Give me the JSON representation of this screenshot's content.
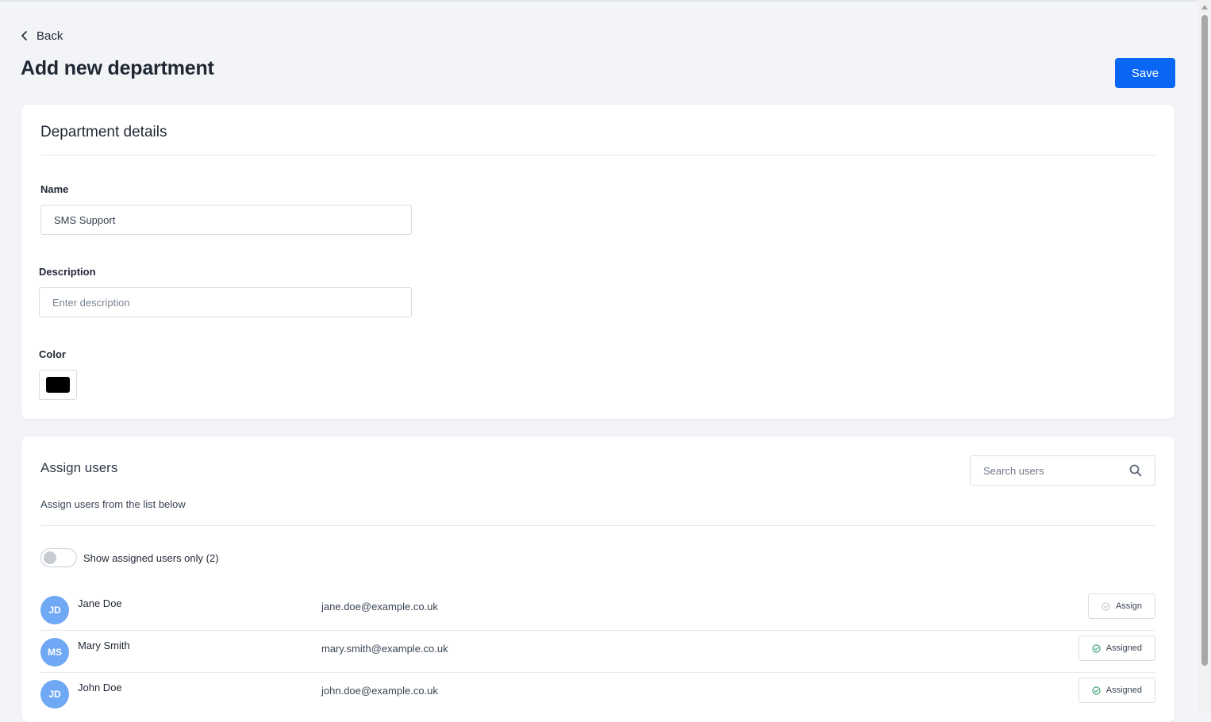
{
  "header": {
    "back_label": "Back",
    "page_title": "Add new department",
    "save_label": "Save"
  },
  "details": {
    "title": "Department details",
    "name_label": "Name",
    "name_value": "SMS Support",
    "description_label": "Description",
    "description_placeholder": "Enter description",
    "color_label": "Color",
    "color_value": "#000000"
  },
  "assign": {
    "title": "Assign users",
    "subtitle": "Assign users from the list below",
    "search_placeholder": "Search users",
    "toggle_label": "Show assigned users only (2)",
    "users": [
      {
        "initials": "JD",
        "name": "Jane Doe",
        "email": "jane.doe@example.co.uk",
        "status": "Assign"
      },
      {
        "initials": "MS",
        "name": "Mary Smith",
        "email": "mary.smith@example.co.uk",
        "status": "Assigned"
      },
      {
        "initials": "JD",
        "name": "John Doe",
        "email": "john.doe@example.co.uk",
        "status": "Assigned"
      }
    ]
  },
  "colors": {
    "primary": "#0a66f5",
    "avatar": "#6fa8f4",
    "assigned_check": "#2f9e6b",
    "unassigned_check": "#c4c9d0"
  }
}
